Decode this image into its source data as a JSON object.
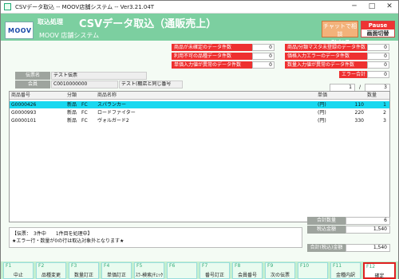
{
  "window": {
    "title": "CSVデータ取込 -- MOOV店舗システム -- Ver3.21.04T",
    "min": "─",
    "max": "□",
    "close": "✕"
  },
  "header": {
    "logo": "MOOV",
    "torikomi": "取込処理",
    "title": "CSVデータ取込（通販売上）",
    "system": "MOOV 店舗システム",
    "chat_line1": "チャットで相談",
    "chat_line2": "Ctrl+Z",
    "pause_line1": "Pause",
    "pause_line2": "画面切替"
  },
  "errors_left": [
    {
      "label": "商品が未確定のデータ件数",
      "count": "0"
    },
    {
      "label": "利用不可の品種データ件数",
      "count": "0"
    },
    {
      "label": "単価入力値が異常のデータ件数",
      "count": "0"
    }
  ],
  "errors_right": [
    {
      "label": "商品/分類マスタ未登録のデータ件数",
      "count": "0"
    },
    {
      "label": "価格入力エラーのデータ件数",
      "count": "0"
    },
    {
      "label": "数量入力値が異常のデータ件数",
      "count": "0"
    }
  ],
  "error_total": {
    "label": "エラー合計",
    "count": "0"
  },
  "slip": {
    "slip_label": "伝票名",
    "slip_value": "テスト伝票",
    "member_label": "会員",
    "member_value": "C0010000000",
    "member_name": "テスト(棚店と同じ番号"
  },
  "pager": {
    "current": "1",
    "sep": "/",
    "total": "3"
  },
  "columns": {
    "code": "商品番号",
    "category": "分類",
    "name": "商品名称",
    "unit_price": "単価",
    "qty": "数量"
  },
  "rows": [
    {
      "code": "G0000426",
      "type": "新品",
      "fc": "FC",
      "name": "スパランカー",
      "unit": "(円)",
      "price": "110",
      "qty": "1"
    },
    {
      "code": "G0000993",
      "type": "新品",
      "fc": "FC",
      "name": "ロードファイター",
      "unit": "(円)",
      "price": "220",
      "qty": "2"
    },
    {
      "code": "G0000101",
      "type": "新品",
      "fc": "FC",
      "name": "ヴォルガード2",
      "unit": "(円)",
      "price": "330",
      "qty": "3"
    }
  ],
  "status": {
    "line1": "【伝票：　3件中　　1件目を処理中】",
    "line2": "★エラー行・数量が0の行は取込対象外となります★"
  },
  "totals": {
    "qty_label": "合計数量",
    "qty_value": "6",
    "tax_label": "税込金額",
    "tax_value": "1,540",
    "all_label": "合計(税込)金額",
    "all_value": "1,540"
  },
  "fkeys": [
    {
      "key": "F1",
      "label": "中止"
    },
    {
      "key": "F2",
      "label": "品種変更"
    },
    {
      "key": "F3",
      "label": "数量訂正"
    },
    {
      "key": "F4",
      "label": "単価訂正"
    },
    {
      "key": "F5",
      "label": "ｽﾗ-検索/ﾁｪｯｸ"
    },
    {
      "key": "F6",
      "label": ""
    },
    {
      "key": "F7",
      "label": "番号訂正"
    },
    {
      "key": "F8",
      "label": "会員番号"
    },
    {
      "key": "F9",
      "label": "次の伝票"
    },
    {
      "key": "F10",
      "label": ""
    },
    {
      "key": "F11",
      "label": "金種内訳"
    },
    {
      "key": "F12",
      "label": "確定"
    }
  ],
  "colors": {
    "header": "#7ccfa0",
    "error": "#ee3030",
    "selected_row": "#18d8f0",
    "highlight": "#e02020"
  }
}
